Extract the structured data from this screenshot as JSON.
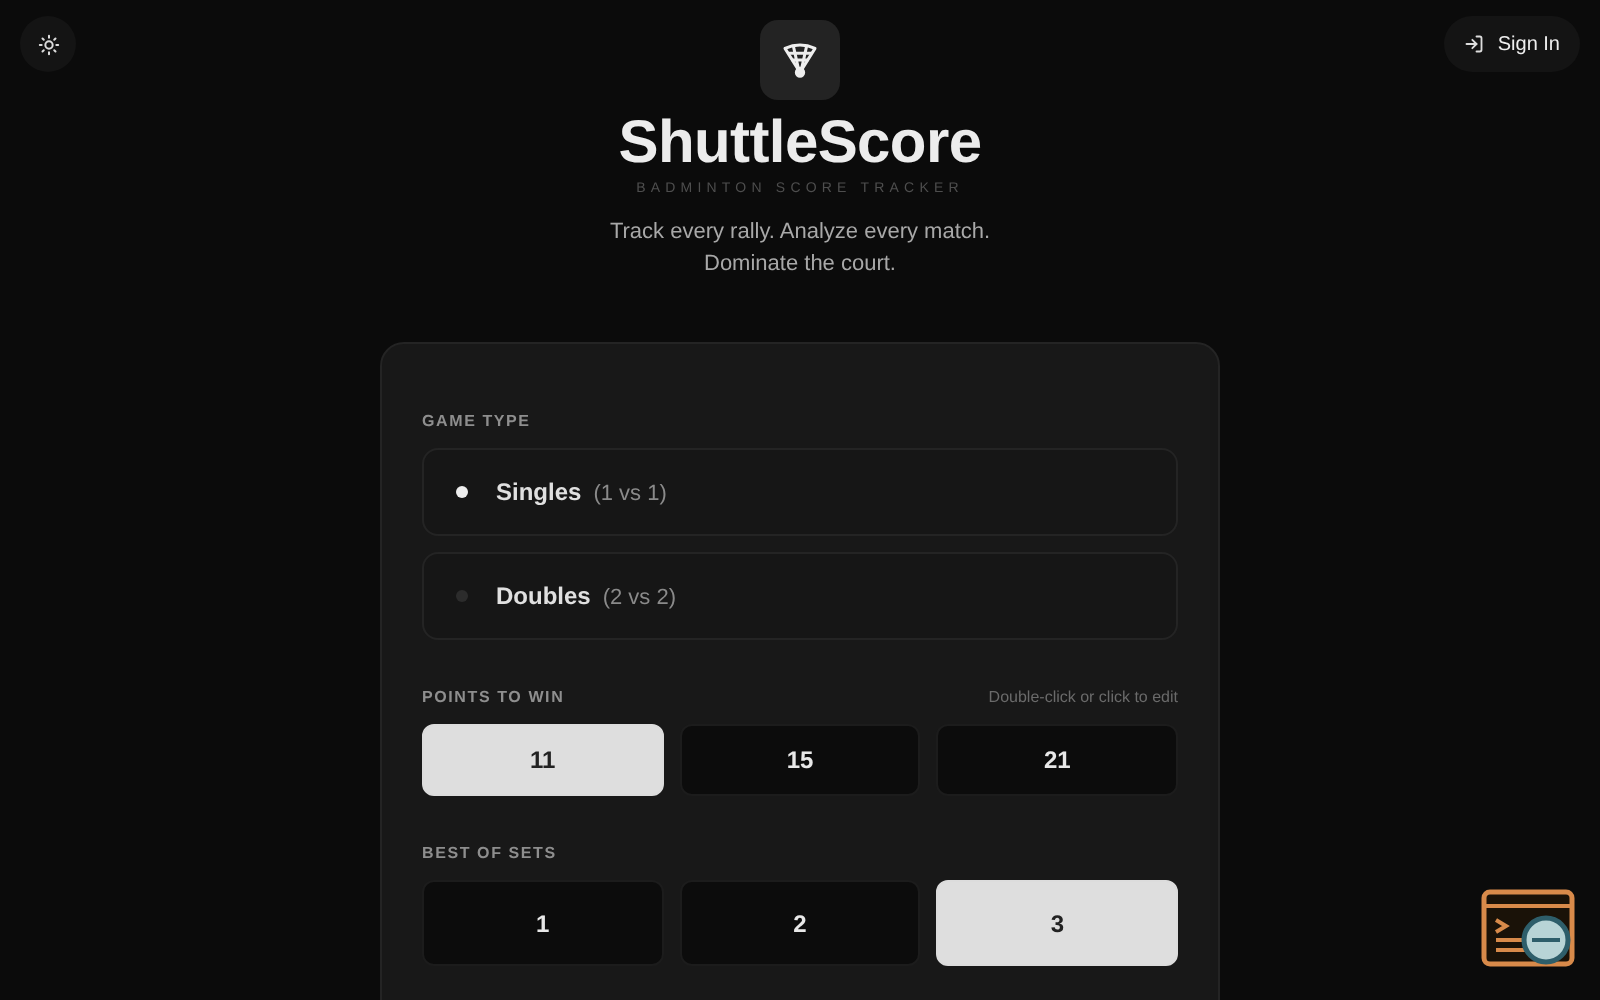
{
  "header": {
    "sign_in": "Sign In",
    "title": "ShuttleScore",
    "subtitle": "BADMINTON SCORE TRACKER",
    "tagline": [
      "Track every rally. Analyze every match.",
      "Dominate the court."
    ]
  },
  "game_type": {
    "label": "GAME TYPE",
    "options": [
      {
        "name": "Singles",
        "detail": "(1 vs 1)",
        "selected": true
      },
      {
        "name": "Doubles",
        "detail": "(2 vs 2)",
        "selected": false
      }
    ]
  },
  "points_to_win": {
    "label": "POINTS TO WIN",
    "hint": "Double-click or click to edit",
    "options": [
      {
        "label": "11",
        "selected": true
      },
      {
        "label": "15",
        "selected": false
      },
      {
        "label": "21",
        "selected": false
      }
    ]
  },
  "best_of_sets": {
    "label": "BEST OF SETS",
    "options": [
      {
        "label": "1",
        "selected": false
      },
      {
        "label": "2",
        "selected": false
      },
      {
        "label": "3",
        "selected": true
      }
    ]
  }
}
